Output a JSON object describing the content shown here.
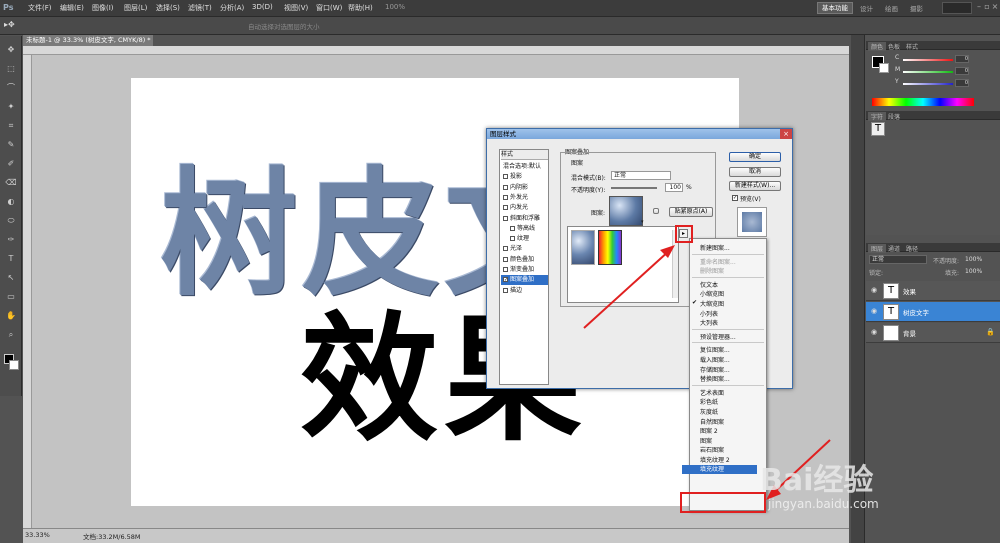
{
  "menubar": {
    "logo": "Ps",
    "items": [
      "文件(F)",
      "编辑(E)",
      "图像(I)",
      "图层(L)",
      "选择(S)",
      "滤镜(T)",
      "分析(A)",
      "3D(D)",
      "视图(V)",
      "窗口(W)",
      "帮助(H)"
    ],
    "zoom": "100%",
    "workspaces": [
      "基本功能",
      "设计",
      "绘画",
      "摄影"
    ]
  },
  "optbar": {
    "hint": "自动选择对选图层的大小"
  },
  "document": {
    "tab_title": "未标题-1 @ 33.3% (树皮文字, CMYK/8) *",
    "text_line1": "树皮文",
    "text_line2": "效果",
    "zoom": "33.33%",
    "doc_info": "文档:33.2M/6.58M"
  },
  "dialog": {
    "title": "图层样式",
    "styles_header": "样式",
    "style_items": [
      {
        "label": "混合选项:默认",
        "checkbox": false,
        "indent": 0
      },
      {
        "label": "投影",
        "checkbox": true,
        "indent": 0
      },
      {
        "label": "内阴影",
        "checkbox": true,
        "indent": 0
      },
      {
        "label": "外发光",
        "checkbox": true,
        "indent": 0
      },
      {
        "label": "内发光",
        "checkbox": true,
        "indent": 0
      },
      {
        "label": "斜面和浮雕",
        "checkbox": true,
        "indent": 0
      },
      {
        "label": "等高线",
        "checkbox": true,
        "indent": 1
      },
      {
        "label": "纹理",
        "checkbox": true,
        "indent": 1
      },
      {
        "label": "光泽",
        "checkbox": true,
        "indent": 0
      },
      {
        "label": "颜色叠加",
        "checkbox": true,
        "indent": 0
      },
      {
        "label": "渐变叠加",
        "checkbox": true,
        "indent": 0
      },
      {
        "label": "图案叠加",
        "checkbox": true,
        "indent": 0,
        "selected": true
      },
      {
        "label": "描边",
        "checkbox": true,
        "indent": 0
      }
    ],
    "section_title": "图案叠加",
    "subsection": "图案",
    "blend_mode_label": "混合模式(B):",
    "blend_mode_value": "正常",
    "opacity_label": "不透明度(Y):",
    "opacity_value": "100",
    "opacity_unit": "%",
    "pattern_label": "图案:",
    "snap_button": "贴紧原点(A)",
    "ok": "确定",
    "cancel": "取消",
    "new_style": "新建样式(W)...",
    "preview_label": "预览(V)"
  },
  "picker_menu": {
    "items": [
      {
        "label": "新建图案...",
        "disabled": false
      },
      {
        "sep": true
      },
      {
        "label": "重命名图案...",
        "disabled": true
      },
      {
        "label": "删除图案",
        "disabled": true
      },
      {
        "sep": true
      },
      {
        "label": "仅文本",
        "disabled": false
      },
      {
        "label": "小缩览图",
        "disabled": false
      },
      {
        "label": "大缩览图",
        "disabled": false,
        "checked": true
      },
      {
        "label": "小列表",
        "disabled": false
      },
      {
        "label": "大列表",
        "disabled": false
      },
      {
        "sep": true
      },
      {
        "label": "预设管理器...",
        "disabled": false
      },
      {
        "sep": true
      },
      {
        "label": "复位图案...",
        "disabled": false
      },
      {
        "label": "载入图案...",
        "disabled": false
      },
      {
        "label": "存储图案...",
        "disabled": false
      },
      {
        "label": "替换图案...",
        "disabled": false
      },
      {
        "sep": true
      },
      {
        "label": "艺术表面",
        "disabled": false
      },
      {
        "label": "彩色纸",
        "disabled": false
      },
      {
        "label": "灰度纸",
        "disabled": false
      },
      {
        "label": "自然图案",
        "disabled": false
      },
      {
        "label": "图案 2",
        "disabled": false
      },
      {
        "label": "图案",
        "disabled": false
      },
      {
        "label": "岩石图案",
        "disabled": false
      },
      {
        "label": "填充纹理 2",
        "disabled": false
      },
      {
        "label": "填充纹理",
        "disabled": false,
        "highlighted": true
      }
    ]
  },
  "panels": {
    "color_tabs": [
      "颜色",
      "色板",
      "样式"
    ],
    "channels": [
      "C",
      "M",
      "Y",
      "K"
    ],
    "channel_values": [
      "0",
      "0",
      "0",
      "100"
    ],
    "char_tabs": [
      "字符",
      "段落"
    ],
    "layers_tabs": [
      "图层",
      "通道",
      "路径"
    ],
    "blend_mode": "正常",
    "opacity_label": "不透明度:",
    "opacity_value": "100%",
    "lock_label": "锁定:",
    "fill_label": "填充:",
    "fill_value": "100%",
    "layers": [
      {
        "name": "效果",
        "type": "text"
      },
      {
        "name": "树皮文字",
        "type": "text",
        "selected": true
      },
      {
        "name": "背景",
        "type": "bg"
      }
    ]
  },
  "watermark": {
    "brand": "Bai经验",
    "url": "jingyan.baidu.com"
  },
  "colors": {
    "accent": "#2f6fc6",
    "annotation": "#e02020",
    "texture": "#6e84a6"
  }
}
